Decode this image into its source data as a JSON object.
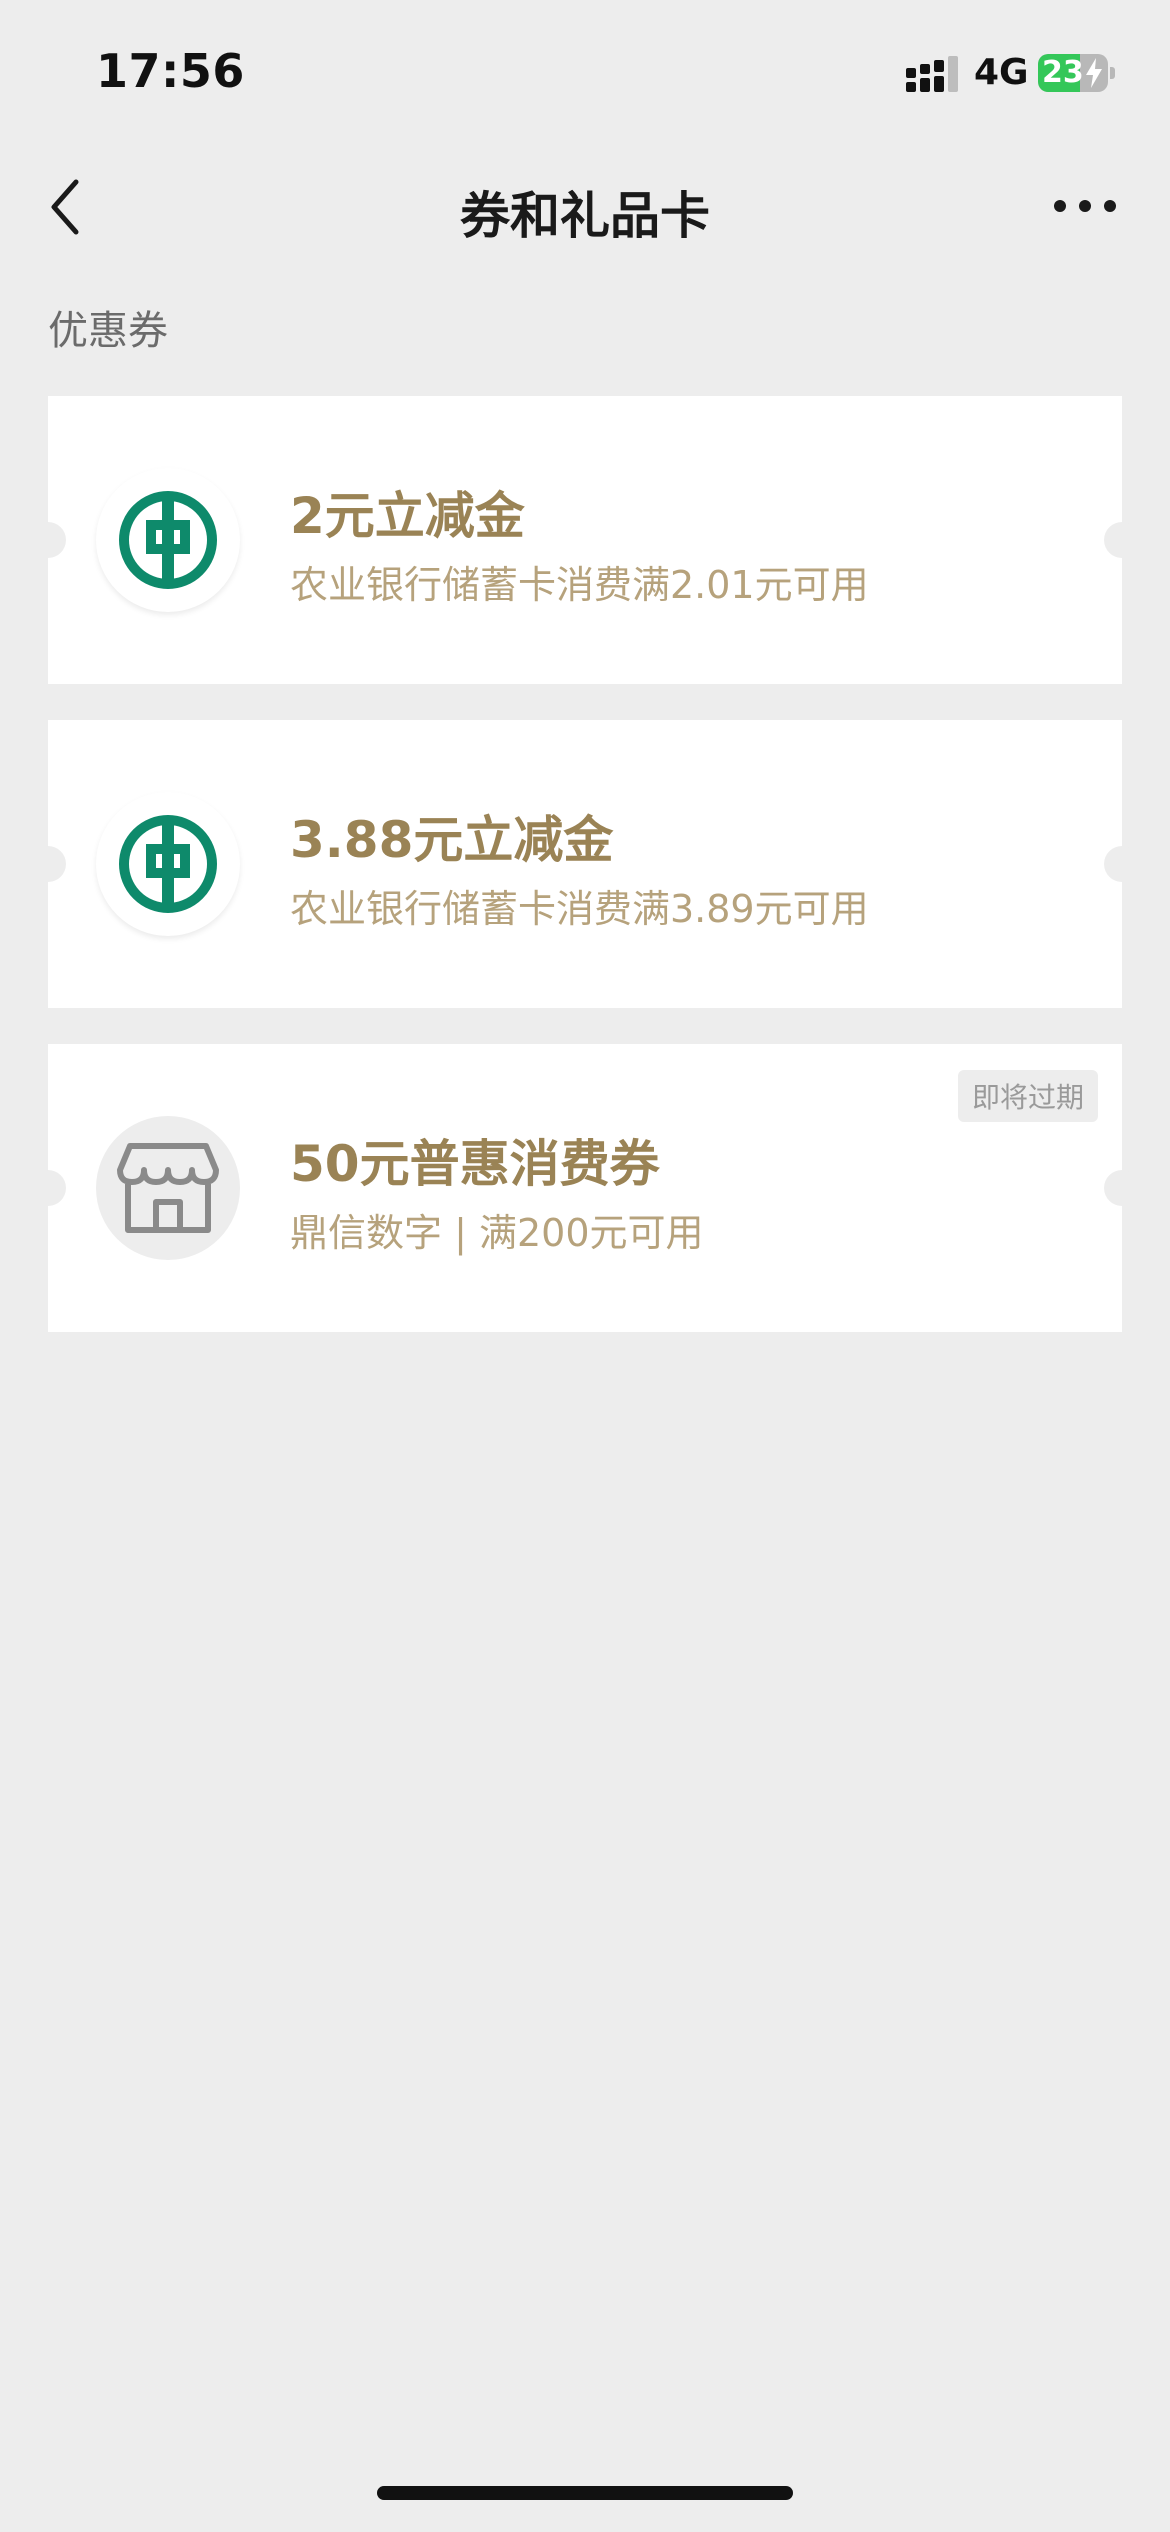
{
  "status_bar": {
    "time": "17:56",
    "network": "4G",
    "battery_level": "23",
    "battery_fraction": 0.23,
    "battery_charging": true
  },
  "nav": {
    "title": "券和礼品卡",
    "back_icon": "chevron-left-icon",
    "more_icon": "more-dots-icon"
  },
  "section": {
    "label": "优惠券"
  },
  "coupons": [
    {
      "title": "2元立减金",
      "description": "农业银行储蓄卡消费满2.01元可用",
      "logo": "abc-bank-logo",
      "badge": ""
    },
    {
      "title": "3.88元立减金",
      "description": "农业银行储蓄卡消费满3.89元可用",
      "logo": "abc-bank-logo",
      "badge": ""
    },
    {
      "title": "50元普惠消费券",
      "description": "鼎信数字 | 满200元可用",
      "logo": "store-icon",
      "badge": "即将过期"
    }
  ],
  "colors": {
    "background": "#ededed",
    "card": "#ffffff",
    "coupon_title": "#9a8355",
    "coupon_desc": "#b6a27c",
    "bank_green": "#0e8a6b",
    "battery_green": "#34c759"
  }
}
